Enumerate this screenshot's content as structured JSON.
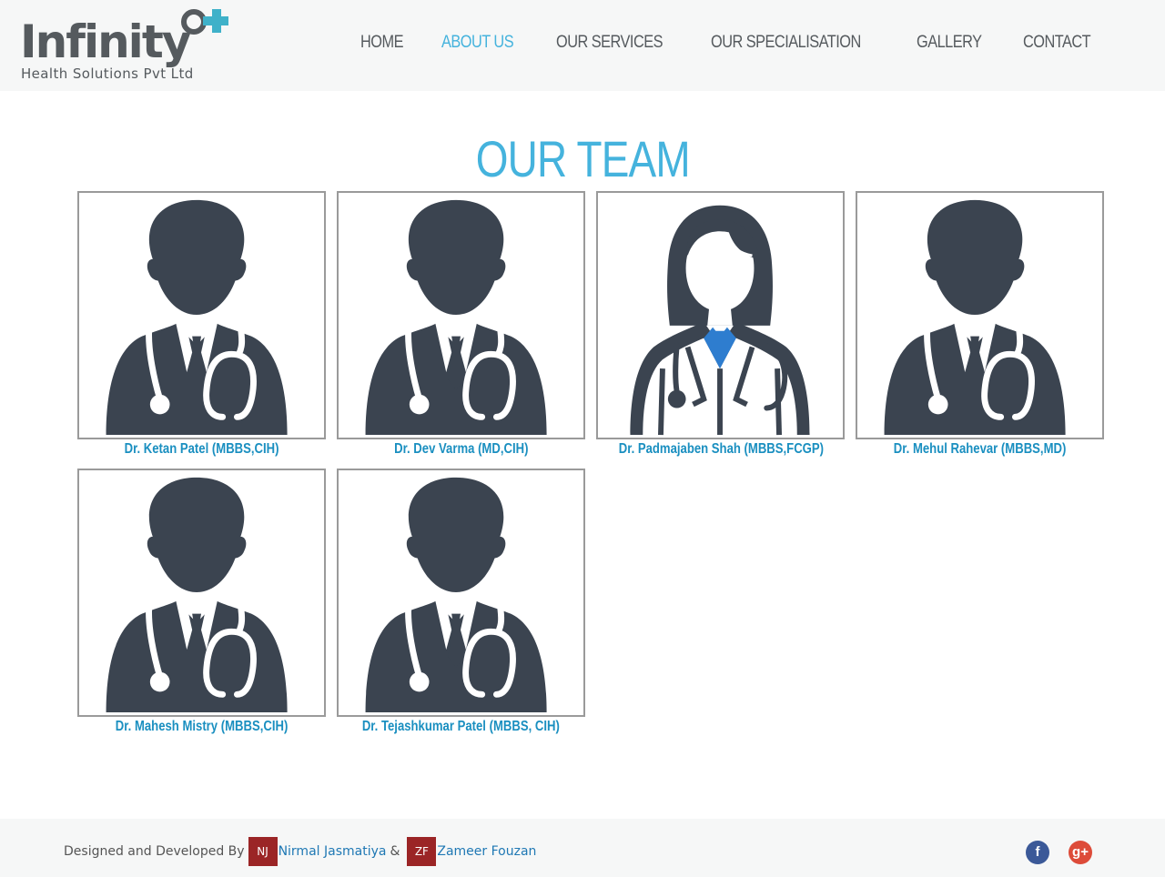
{
  "brand": {
    "name": "Infinity",
    "tagline": "Health Solutions Pvt Ltd",
    "accent_color": "#45b3dd",
    "text_color": "#555a5e"
  },
  "nav": {
    "items": [
      {
        "label": "HOME",
        "active": false
      },
      {
        "label": "ABOUT US",
        "active": true
      },
      {
        "label": "OUR SERVICES",
        "active": false
      },
      {
        "label": "OUR SPECIALISATION",
        "active": false
      },
      {
        "label": "GALLERY",
        "active": false
      },
      {
        "label": "CONTACT",
        "active": false
      }
    ]
  },
  "page": {
    "title": "OUR TEAM"
  },
  "team": [
    {
      "name": "Dr. Ketan Patel (MBBS,CIH)",
      "icon": "male-doctor-icon"
    },
    {
      "name": "Dr. Dev Varma (MD,CIH)",
      "icon": "male-doctor-icon"
    },
    {
      "name": "Dr. Padmajaben Shah (MBBS,FCGP)",
      "icon": "female-doctor-icon"
    },
    {
      "name": "Dr. Mehul Rahevar (MBBS,MD)",
      "icon": "male-doctor-icon"
    },
    {
      "name": "Dr. Mahesh Mistry (MBBS,CIH)",
      "icon": "male-doctor-icon"
    },
    {
      "name": "Dr. Tejashkumar Patel (MBBS, CIH)",
      "icon": "male-doctor-icon"
    }
  ],
  "footer": {
    "credit_prefix": "Designed and Developed By",
    "developer1_initials": "NJ",
    "developer1_name": "Nirmal Jasmatiya",
    "amp": "&",
    "developer2_initials": "ZF",
    "developer2_name": "Zameer Fouzan",
    "social": [
      {
        "icon": "facebook-icon",
        "glyph": "f"
      },
      {
        "icon": "google-plus-icon",
        "glyph": "g+"
      }
    ]
  }
}
